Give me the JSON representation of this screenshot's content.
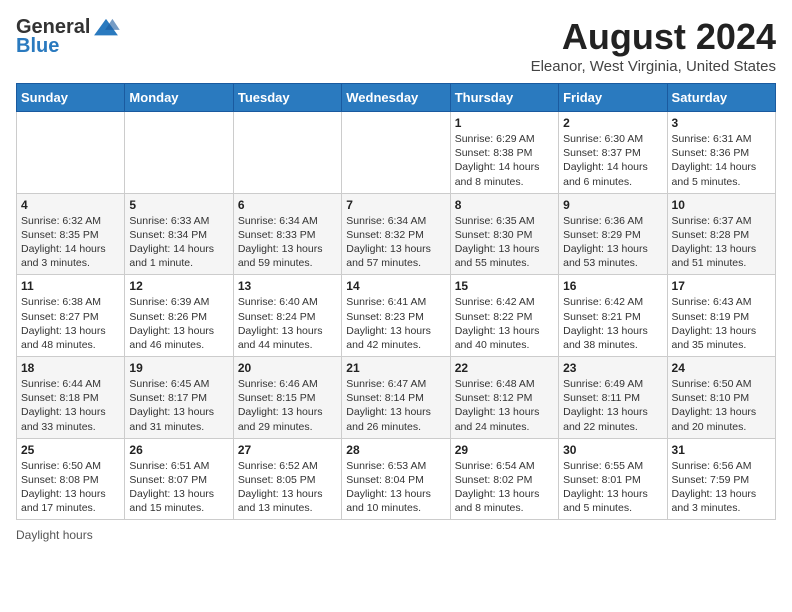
{
  "header": {
    "logo_general": "General",
    "logo_blue": "Blue",
    "title": "August 2024",
    "subtitle": "Eleanor, West Virginia, United States"
  },
  "days_of_week": [
    "Sunday",
    "Monday",
    "Tuesday",
    "Wednesday",
    "Thursday",
    "Friday",
    "Saturday"
  ],
  "weeks": [
    [
      {
        "day": "",
        "info": ""
      },
      {
        "day": "",
        "info": ""
      },
      {
        "day": "",
        "info": ""
      },
      {
        "day": "",
        "info": ""
      },
      {
        "day": "1",
        "info": "Sunrise: 6:29 AM\nSunset: 8:38 PM\nDaylight: 14 hours and 8 minutes."
      },
      {
        "day": "2",
        "info": "Sunrise: 6:30 AM\nSunset: 8:37 PM\nDaylight: 14 hours and 6 minutes."
      },
      {
        "day": "3",
        "info": "Sunrise: 6:31 AM\nSunset: 8:36 PM\nDaylight: 14 hours and 5 minutes."
      }
    ],
    [
      {
        "day": "4",
        "info": "Sunrise: 6:32 AM\nSunset: 8:35 PM\nDaylight: 14 hours and 3 minutes."
      },
      {
        "day": "5",
        "info": "Sunrise: 6:33 AM\nSunset: 8:34 PM\nDaylight: 14 hours and 1 minute."
      },
      {
        "day": "6",
        "info": "Sunrise: 6:34 AM\nSunset: 8:33 PM\nDaylight: 13 hours and 59 minutes."
      },
      {
        "day": "7",
        "info": "Sunrise: 6:34 AM\nSunset: 8:32 PM\nDaylight: 13 hours and 57 minutes."
      },
      {
        "day": "8",
        "info": "Sunrise: 6:35 AM\nSunset: 8:30 PM\nDaylight: 13 hours and 55 minutes."
      },
      {
        "day": "9",
        "info": "Sunrise: 6:36 AM\nSunset: 8:29 PM\nDaylight: 13 hours and 53 minutes."
      },
      {
        "day": "10",
        "info": "Sunrise: 6:37 AM\nSunset: 8:28 PM\nDaylight: 13 hours and 51 minutes."
      }
    ],
    [
      {
        "day": "11",
        "info": "Sunrise: 6:38 AM\nSunset: 8:27 PM\nDaylight: 13 hours and 48 minutes."
      },
      {
        "day": "12",
        "info": "Sunrise: 6:39 AM\nSunset: 8:26 PM\nDaylight: 13 hours and 46 minutes."
      },
      {
        "day": "13",
        "info": "Sunrise: 6:40 AM\nSunset: 8:24 PM\nDaylight: 13 hours and 44 minutes."
      },
      {
        "day": "14",
        "info": "Sunrise: 6:41 AM\nSunset: 8:23 PM\nDaylight: 13 hours and 42 minutes."
      },
      {
        "day": "15",
        "info": "Sunrise: 6:42 AM\nSunset: 8:22 PM\nDaylight: 13 hours and 40 minutes."
      },
      {
        "day": "16",
        "info": "Sunrise: 6:42 AM\nSunset: 8:21 PM\nDaylight: 13 hours and 38 minutes."
      },
      {
        "day": "17",
        "info": "Sunrise: 6:43 AM\nSunset: 8:19 PM\nDaylight: 13 hours and 35 minutes."
      }
    ],
    [
      {
        "day": "18",
        "info": "Sunrise: 6:44 AM\nSunset: 8:18 PM\nDaylight: 13 hours and 33 minutes."
      },
      {
        "day": "19",
        "info": "Sunrise: 6:45 AM\nSunset: 8:17 PM\nDaylight: 13 hours and 31 minutes."
      },
      {
        "day": "20",
        "info": "Sunrise: 6:46 AM\nSunset: 8:15 PM\nDaylight: 13 hours and 29 minutes."
      },
      {
        "day": "21",
        "info": "Sunrise: 6:47 AM\nSunset: 8:14 PM\nDaylight: 13 hours and 26 minutes."
      },
      {
        "day": "22",
        "info": "Sunrise: 6:48 AM\nSunset: 8:12 PM\nDaylight: 13 hours and 24 minutes."
      },
      {
        "day": "23",
        "info": "Sunrise: 6:49 AM\nSunset: 8:11 PM\nDaylight: 13 hours and 22 minutes."
      },
      {
        "day": "24",
        "info": "Sunrise: 6:50 AM\nSunset: 8:10 PM\nDaylight: 13 hours and 20 minutes."
      }
    ],
    [
      {
        "day": "25",
        "info": "Sunrise: 6:50 AM\nSunset: 8:08 PM\nDaylight: 13 hours and 17 minutes."
      },
      {
        "day": "26",
        "info": "Sunrise: 6:51 AM\nSunset: 8:07 PM\nDaylight: 13 hours and 15 minutes."
      },
      {
        "day": "27",
        "info": "Sunrise: 6:52 AM\nSunset: 8:05 PM\nDaylight: 13 hours and 13 minutes."
      },
      {
        "day": "28",
        "info": "Sunrise: 6:53 AM\nSunset: 8:04 PM\nDaylight: 13 hours and 10 minutes."
      },
      {
        "day": "29",
        "info": "Sunrise: 6:54 AM\nSunset: 8:02 PM\nDaylight: 13 hours and 8 minutes."
      },
      {
        "day": "30",
        "info": "Sunrise: 6:55 AM\nSunset: 8:01 PM\nDaylight: 13 hours and 5 minutes."
      },
      {
        "day": "31",
        "info": "Sunrise: 6:56 AM\nSunset: 7:59 PM\nDaylight: 13 hours and 3 minutes."
      }
    ]
  ],
  "footer": {
    "daylight_label": "Daylight hours"
  }
}
